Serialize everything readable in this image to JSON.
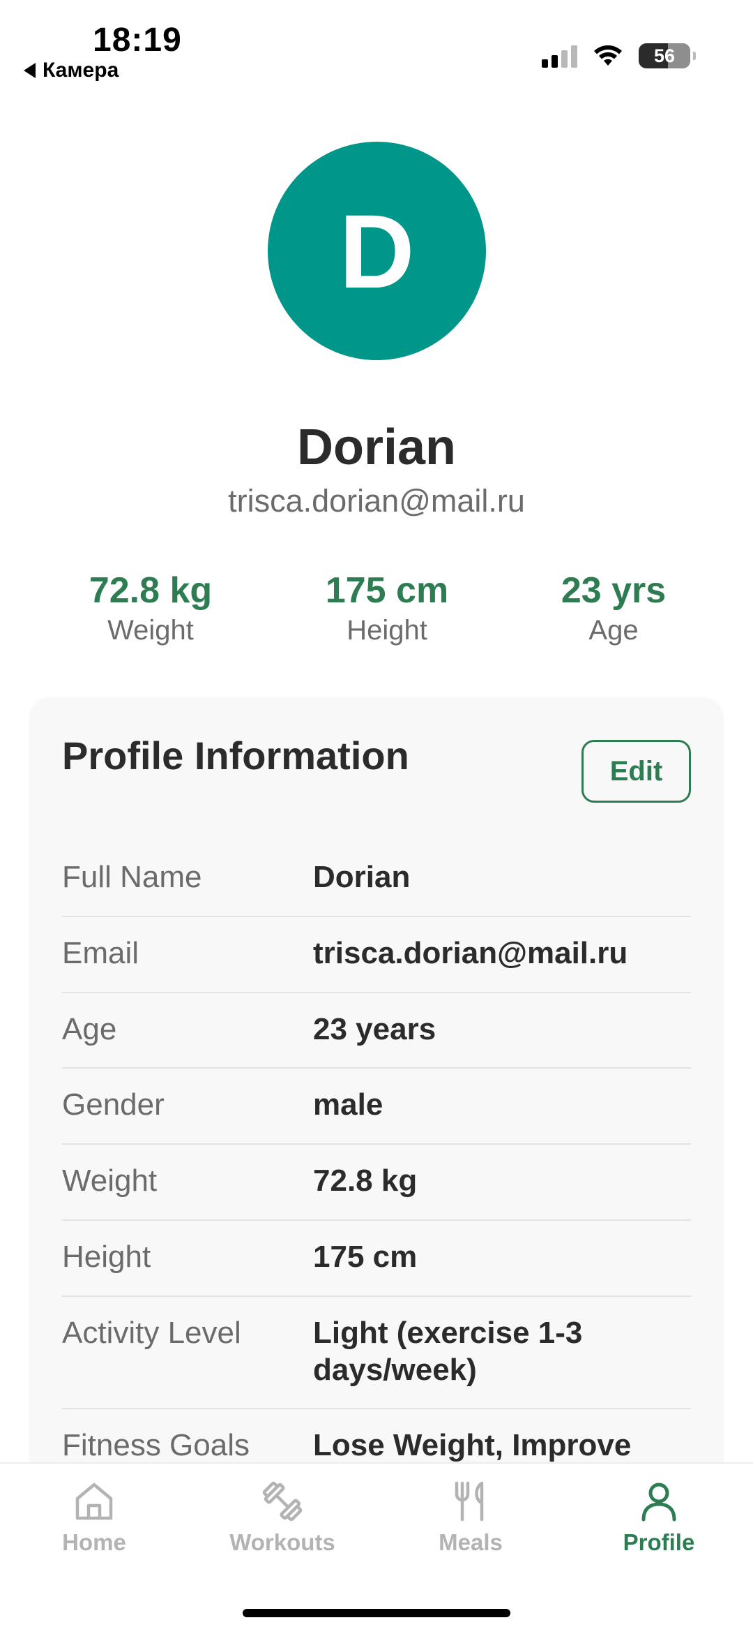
{
  "status_bar": {
    "time": "18:19",
    "back_app": "Камера",
    "battery": "56"
  },
  "profile": {
    "avatar_letter": "D",
    "name": "Dorian",
    "email": "trisca.dorian@mail.ru"
  },
  "stats": [
    {
      "value": "72.8 kg",
      "label": "Weight"
    },
    {
      "value": "175 cm",
      "label": "Height"
    },
    {
      "value": "23 yrs",
      "label": "Age"
    }
  ],
  "card": {
    "title": "Profile Information",
    "edit_label": "Edit",
    "rows": [
      {
        "label": "Full Name",
        "value": "Dorian"
      },
      {
        "label": "Email",
        "value": "trisca.dorian@mail.ru"
      },
      {
        "label": "Age",
        "value": "23 years"
      },
      {
        "label": "Gender",
        "value": "male"
      },
      {
        "label": "Weight",
        "value": "72.8 kg"
      },
      {
        "label": "Height",
        "value": "175 cm"
      },
      {
        "label": "Activity Level",
        "value": "Light (exercise 1-3 days/week)"
      },
      {
        "label": "Fitness Goals",
        "value": "Lose Weight, Improve"
      }
    ]
  },
  "tabs": [
    {
      "label": "Home",
      "icon": "home-icon",
      "active": false
    },
    {
      "label": "Workouts",
      "icon": "dumbbell-icon",
      "active": false
    },
    {
      "label": "Meals",
      "icon": "fork-knife-icon",
      "active": false
    },
    {
      "label": "Profile",
      "icon": "user-icon",
      "active": true
    }
  ],
  "colors": {
    "accent": "#2e7d52",
    "avatar": "#01968a",
    "inactive_tab": "#b3b3b3"
  }
}
